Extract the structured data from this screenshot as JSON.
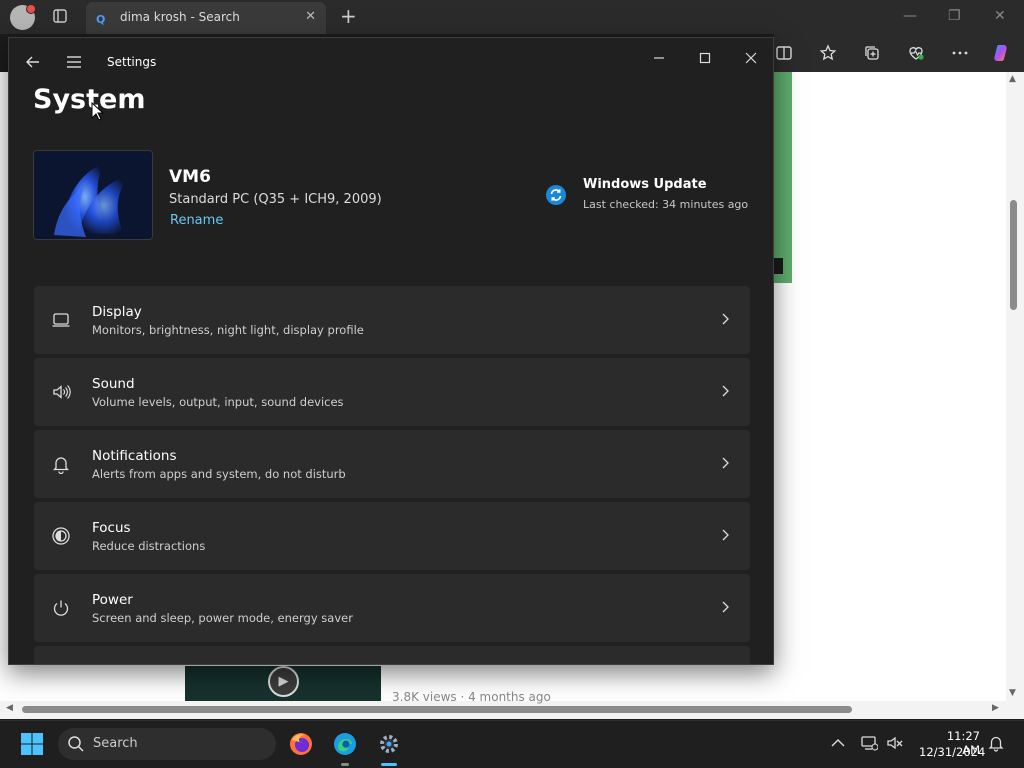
{
  "browser": {
    "tab_title": "dima krosh - Search",
    "new_tab_label": "+",
    "video_views": "3.8K views · 4 months ago"
  },
  "settings": {
    "window_title": "Settings",
    "page_title": "System",
    "device": {
      "name": "VM6",
      "model": "Standard PC (Q35 + ICH9, 2009)",
      "rename_label": "Rename"
    },
    "windows_update": {
      "title": "Windows Update",
      "status": "Last checked: 34 minutes ago"
    },
    "items": [
      {
        "title": "Display",
        "desc": "Monitors, brightness, night light, display profile",
        "icon": "display-icon"
      },
      {
        "title": "Sound",
        "desc": "Volume levels, output, input, sound devices",
        "icon": "speaker-icon"
      },
      {
        "title": "Notifications",
        "desc": "Alerts from apps and system, do not disturb",
        "icon": "bell-icon"
      },
      {
        "title": "Focus",
        "desc": "Reduce distractions",
        "icon": "focus-icon"
      },
      {
        "title": "Power",
        "desc": "Screen and sleep, power mode, energy saver",
        "icon": "power-icon"
      }
    ]
  },
  "taskbar": {
    "search_placeholder": "Search",
    "time": "11:27 AM",
    "date": "12/31/2024"
  },
  "colors": {
    "accent": "#4cc2ff",
    "link": "#6cc6f0",
    "window_bg": "#202020",
    "card_bg": "#2b2b2b"
  }
}
